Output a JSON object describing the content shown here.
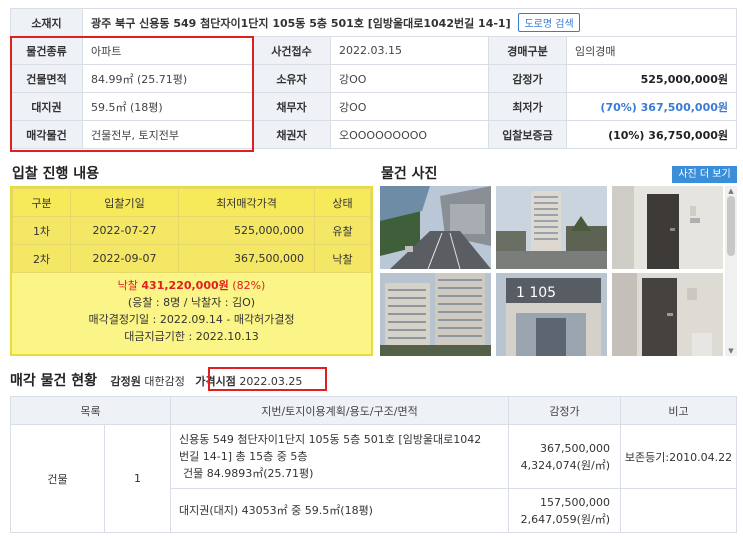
{
  "info": {
    "address_label": "소재지",
    "address": "광주 북구 신용동 549 첨단자이1단지 105동 5층 501호 [임방울대로1042번길 14-1]",
    "road_btn": "도로명 검색",
    "rows": [
      {
        "l1": "물건종류",
        "v1": "아파트",
        "l2": "사건접수",
        "v2": "2022.03.15",
        "l3": "경매구분",
        "v3": "임의경매"
      },
      {
        "l1": "건물면적",
        "v1": "84.99㎡ (25.71평)",
        "l2": "소유자",
        "v2": "강OO",
        "l3": "감정가",
        "v3": "525,000,000원"
      },
      {
        "l1": "대지권",
        "v1": "59.5㎡ (18평)",
        "l2": "채무자",
        "v2": "강OO",
        "l3": "최저가",
        "v3": "(70%) 367,500,000원"
      },
      {
        "l1": "매각물건",
        "v1": "건물전부, 토지전부",
        "l2": "채권자",
        "v2": "오OOOOOOOOO",
        "l3": "입찰보증금",
        "v3": "(10%) 36,750,000원"
      }
    ]
  },
  "bid": {
    "title": "입찰 진행 내용",
    "headers": [
      "구분",
      "입찰기일",
      "최저매각가격",
      "상태"
    ],
    "rows": [
      [
        "1차",
        "2022-07-27",
        "525,000,000",
        "유찰"
      ],
      [
        "2차",
        "2022-09-07",
        "367,500,000",
        "낙찰"
      ]
    ],
    "won_prefix": "낙찰",
    "won_amount": "431,220,000원",
    "won_pct": "(82%)",
    "line2": "(응찰 : 8명 / 낙찰자 : 김O)",
    "line3": "매각결정기일 : 2022.09.14 - 매각허가결정",
    "line4": "대금지급기한 : 2022.10.13"
  },
  "photos": {
    "title": "물건 사진",
    "more_btn": "사진 더 보기",
    "building_number": "1 105"
  },
  "status": {
    "title": "매각 물건 현황",
    "appraiser_label": "감정원",
    "appraiser": "대한감정",
    "price_point_label": "가격시점",
    "price_point": "2022.03.25",
    "headers": [
      "목록",
      "지번/토지이용계획/용도/구조/면적",
      "감정가",
      "비고"
    ],
    "row_type": "건물",
    "row_no": "1",
    "desc1a": "신용동 549 첨단자이1단지 105동 5층 501호 [임방울대로1042",
    "desc1b": "번길 14-1] 총 15층 중 5층",
    "desc1c": "건물 84.9893㎡(25.71평)",
    "price1a": "367,500,000",
    "price1b": "4,324,074(원/㎡)",
    "note1": "보존등기:2010.04.22",
    "desc2": "대지권(대지) 43053㎡ 중 59.5㎡(18평)",
    "price2a": "157,500,000",
    "price2b": "2,647,059(원/㎡)"
  },
  "colors": {
    "accent_blue": "#3a7bd5",
    "highlight_red": "#e02020",
    "bid_yellow": "#fbf486"
  }
}
